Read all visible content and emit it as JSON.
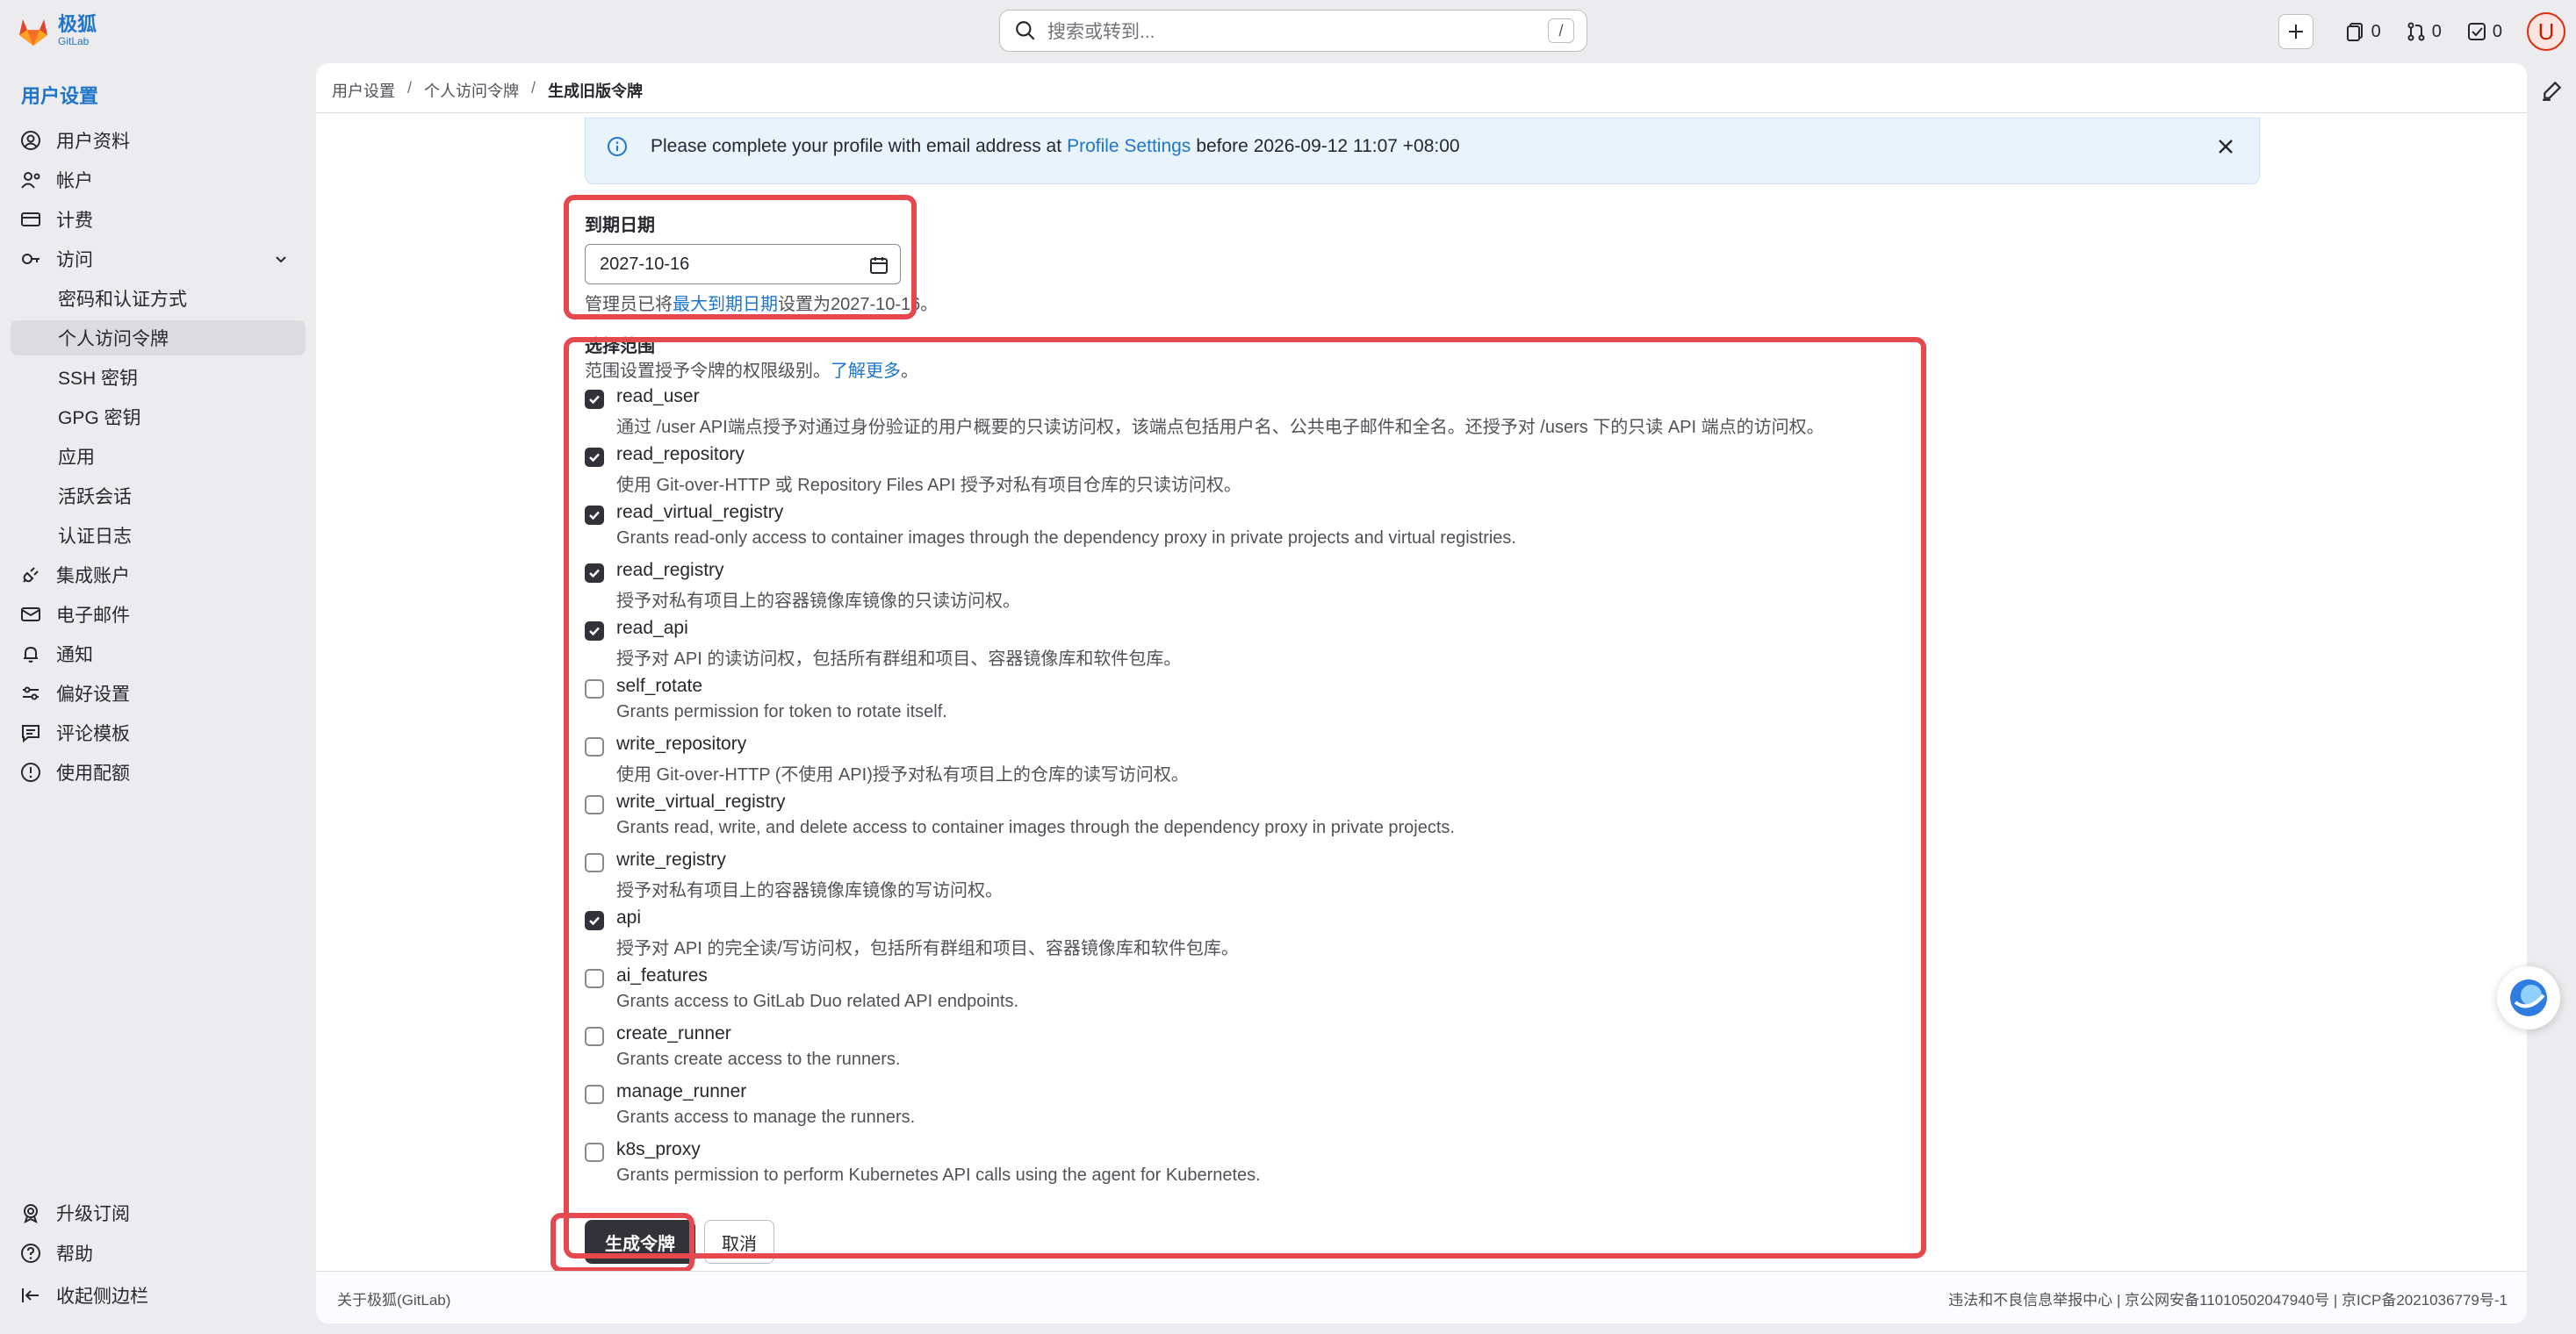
{
  "header": {
    "logo_text": "极狐",
    "logo_sub": "GitLab",
    "search_placeholder": "搜索或转到...",
    "search_shortcut": "/",
    "issues_count": "0",
    "merge_requests_count": "0",
    "todos_count": "0",
    "avatar_initial": "U"
  },
  "sidebar": {
    "title": "用户设置",
    "items": [
      {
        "label": "用户资料",
        "icon": "user-icon"
      },
      {
        "label": "帐户",
        "icon": "account-icon"
      },
      {
        "label": "计费",
        "icon": "credit-card-icon"
      },
      {
        "label": "访问",
        "icon": "key-icon"
      },
      {
        "label": "密码和认证方式"
      },
      {
        "label": "个人访问令牌"
      },
      {
        "label": "SSH 密钥"
      },
      {
        "label": "GPG 密钥"
      },
      {
        "label": "应用"
      },
      {
        "label": "活跃会话"
      },
      {
        "label": "认证日志"
      },
      {
        "label": "集成账户",
        "icon": "plug-icon"
      },
      {
        "label": "电子邮件",
        "icon": "mail-icon"
      },
      {
        "label": "通知",
        "icon": "bell-icon"
      },
      {
        "label": "偏好设置",
        "icon": "preferences-icon"
      },
      {
        "label": "评论模板",
        "icon": "comment-template-icon"
      },
      {
        "label": "使用配额",
        "icon": "quota-icon"
      }
    ],
    "bottom": [
      {
        "label": "升级订阅",
        "icon": "upgrade-icon"
      },
      {
        "label": "帮助",
        "icon": "help-icon"
      },
      {
        "label": "收起侧边栏",
        "icon": "collapse-sidebar-icon"
      }
    ]
  },
  "breadcrumb": [
    "用户设置",
    "个人访问令牌",
    "生成旧版令牌"
  ],
  "alert": {
    "text_before": "Please complete your profile with email address at",
    "link": "Profile Settings",
    "text_after": "before 2026-09-12 11:07 +08:00"
  },
  "expiry": {
    "label": "到期日期",
    "value": "2027-10-16",
    "help_before": "管理员已将",
    "help_link": "最大到期日期",
    "help_after": "设置为2027-10-16。"
  },
  "scopes": {
    "label": "选择范围",
    "help": "范围设置授予令牌的权限级别。",
    "help_link": "了解更多",
    "help_end": "。",
    "items": [
      {
        "name": "read_user",
        "checked": true,
        "desc": "通过 /user API端点授予对通过身份验证的用户概要的只读访问权，该端点包括用户名、公共电子邮件和全名。还授予对 /users 下的只读 API 端点的访问权。"
      },
      {
        "name": "read_repository",
        "checked": true,
        "desc": "使用 Git-over-HTTP 或 Repository Files API 授予对私有项目仓库的只读访问权。"
      },
      {
        "name": "read_virtual_registry",
        "checked": true,
        "desc": "Grants read-only access to container images through the dependency proxy in private projects and virtual registries."
      },
      {
        "name": "read_registry",
        "checked": true,
        "desc": "授予对私有项目上的容器镜像库镜像的只读访问权。"
      },
      {
        "name": "read_api",
        "checked": true,
        "desc": "授予对 API 的读访问权，包括所有群组和项目、容器镜像库和软件包库。"
      },
      {
        "name": "self_rotate",
        "checked": false,
        "desc": "Grants permission for token to rotate itself."
      },
      {
        "name": "write_repository",
        "checked": false,
        "desc": "使用 Git-over-HTTP (不使用 API)授予对私有项目上的仓库的读写访问权。"
      },
      {
        "name": "write_virtual_registry",
        "checked": false,
        "desc": "Grants read, write, and delete access to container images through the dependency proxy in private projects."
      },
      {
        "name": "write_registry",
        "checked": false,
        "desc": "授予对私有项目上的容器镜像库镜像的写访问权。"
      },
      {
        "name": "api",
        "checked": true,
        "desc": "授予对 API 的完全读/写访问权，包括所有群组和项目、容器镜像库和软件包库。"
      },
      {
        "name": "ai_features",
        "checked": false,
        "desc": "Grants access to GitLab Duo related API endpoints."
      },
      {
        "name": "create_runner",
        "checked": false,
        "desc": "Grants create access to the runners."
      },
      {
        "name": "manage_runner",
        "checked": false,
        "desc": "Grants access to manage the runners."
      },
      {
        "name": "k8s_proxy",
        "checked": false,
        "desc": "Grants permission to perform Kubernetes API calls using the agent for Kubernetes."
      }
    ]
  },
  "actions": {
    "submit": "生成令牌",
    "cancel": "取消"
  },
  "footer": {
    "left": "关于极狐(GitLab)",
    "right": "违法和不良信息举报中心 | 京公网安备11010502047940号 | 京ICP备2021036779号-1"
  },
  "colors": {
    "accent": "#1f75cb",
    "annotation_red": "#e5484d",
    "primary_button": "#333238"
  }
}
